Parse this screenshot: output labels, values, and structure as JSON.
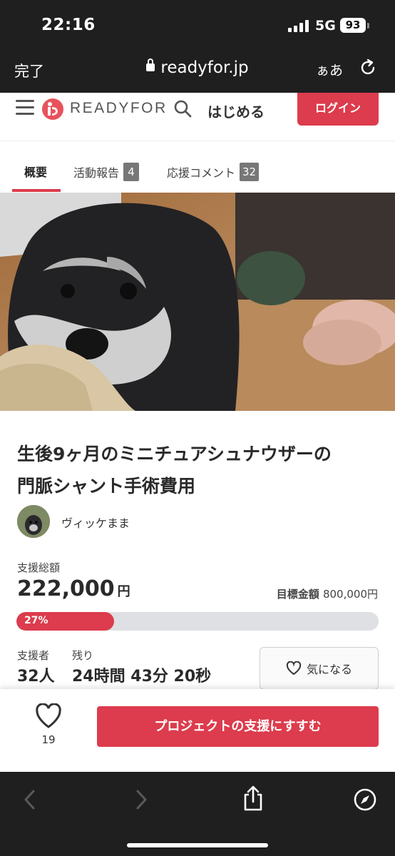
{
  "status_bar": {
    "time": "22:16",
    "network": "5G",
    "battery": "93"
  },
  "browser": {
    "done_label": "完了",
    "url": "readyfor.jp",
    "text_size_label": "ぁあ"
  },
  "header": {
    "logo_text": "READYFOR",
    "start_label": "はじめる",
    "login_label": "ログイン"
  },
  "tabs": [
    {
      "label": "概要",
      "count": null,
      "active": true
    },
    {
      "label": "活動報告",
      "count": "4",
      "active": false
    },
    {
      "label": "応援コメント",
      "count": "32",
      "active": false
    }
  ],
  "project": {
    "title_line1": "生後9ヶ月のミニチュアシュナウザーの",
    "title_line2": "門脈シャント手術費用",
    "owner_name": "ヴィッケまま"
  },
  "funding": {
    "total_label": "支援総額",
    "total_amount": "222,000",
    "total_unit": "円",
    "goal_label": "目標金額",
    "goal_amount": "800,000円",
    "progress_text": "27%",
    "progress_fraction": 0.27,
    "supporters_label": "支援者",
    "supporters_value": "32人",
    "remaining_label": "残り",
    "remaining_value": "24時間 43分 20秒",
    "favorite_label": "気になる"
  },
  "action_bar": {
    "like_count": "19",
    "support_label": "プロジェクトの支援にすすむ"
  },
  "colors": {
    "brand": "#dc3c4d",
    "chrome": "#1f1f1f",
    "progress_track": "#dfe0e3"
  }
}
